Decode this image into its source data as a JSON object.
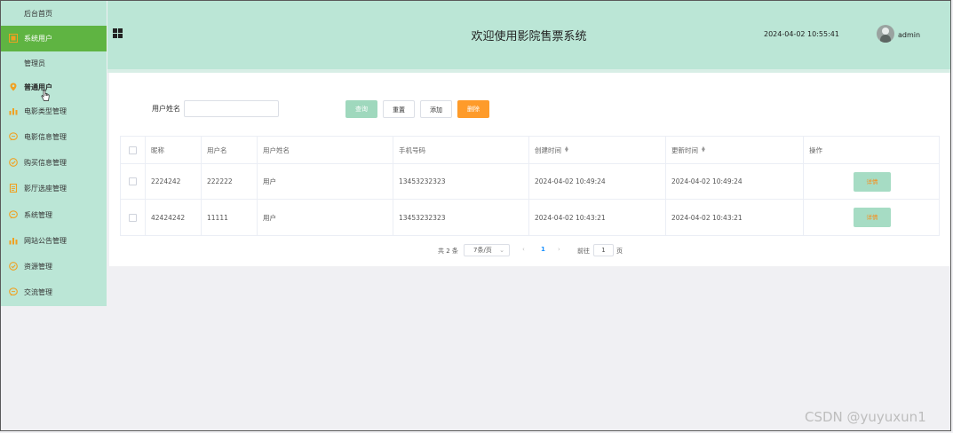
{
  "sidebar": {
    "items": [
      {
        "label": "后台首页",
        "icon": "none"
      },
      {
        "label": "系统用户",
        "icon": "grid-icon",
        "active": true
      },
      {
        "label": "管理员",
        "icon": "none"
      },
      {
        "label": "普通用户",
        "icon": "location-pin-icon"
      },
      {
        "label": "电影类型管理",
        "icon": "bar-chart-icon"
      },
      {
        "label": "电影信息管理",
        "icon": "chat-bubble-icon"
      },
      {
        "label": "购买信息管理",
        "icon": "check-circle-icon"
      },
      {
        "label": "影厅选座管理",
        "icon": "document-icon"
      },
      {
        "label": "系统管理",
        "icon": "chat-bubble-icon"
      },
      {
        "label": "网站公告管理",
        "icon": "bar-chart-icon"
      },
      {
        "label": "资源管理",
        "icon": "check-circle-icon"
      },
      {
        "label": "交流管理",
        "icon": "chat-bubble-icon"
      }
    ],
    "icon_color": "#f0a020",
    "active_color": "#5fb442"
  },
  "header": {
    "title": "欢迎使用影院售票系统",
    "datetime": "2024-04-02 10:55:41",
    "username": "admin",
    "bg_color": "#bbe6d6"
  },
  "search": {
    "label": "用户姓名",
    "value": "",
    "placeholder": ""
  },
  "actions": {
    "query": "查询",
    "reset": "重置",
    "add": "添加",
    "delete": "删除"
  },
  "table": {
    "columns": [
      "昵称",
      "用户名",
      "用户姓名",
      "手机号码",
      "创建时间",
      "更新时间",
      "操作"
    ],
    "rows": [
      {
        "nickname": "2224242",
        "username": "222222",
        "realname": "用户",
        "phone": "13453232323",
        "created": "2024-04-02 10:49:24",
        "updated": "2024-04-02 10:49:24",
        "action": "详情"
      },
      {
        "nickname": "42424242",
        "username": "11111",
        "realname": "用户",
        "phone": "13453232323",
        "created": "2024-04-02 10:43:21",
        "updated": "2024-04-02 10:43:21",
        "action": "详情"
      }
    ]
  },
  "pagination": {
    "total": "共 2 条",
    "page_size": "7条/页",
    "current": "1",
    "goto_label": "前往",
    "goto_value": "1",
    "page_suffix": "页"
  },
  "watermark": "CSDN @yuyuxun1"
}
